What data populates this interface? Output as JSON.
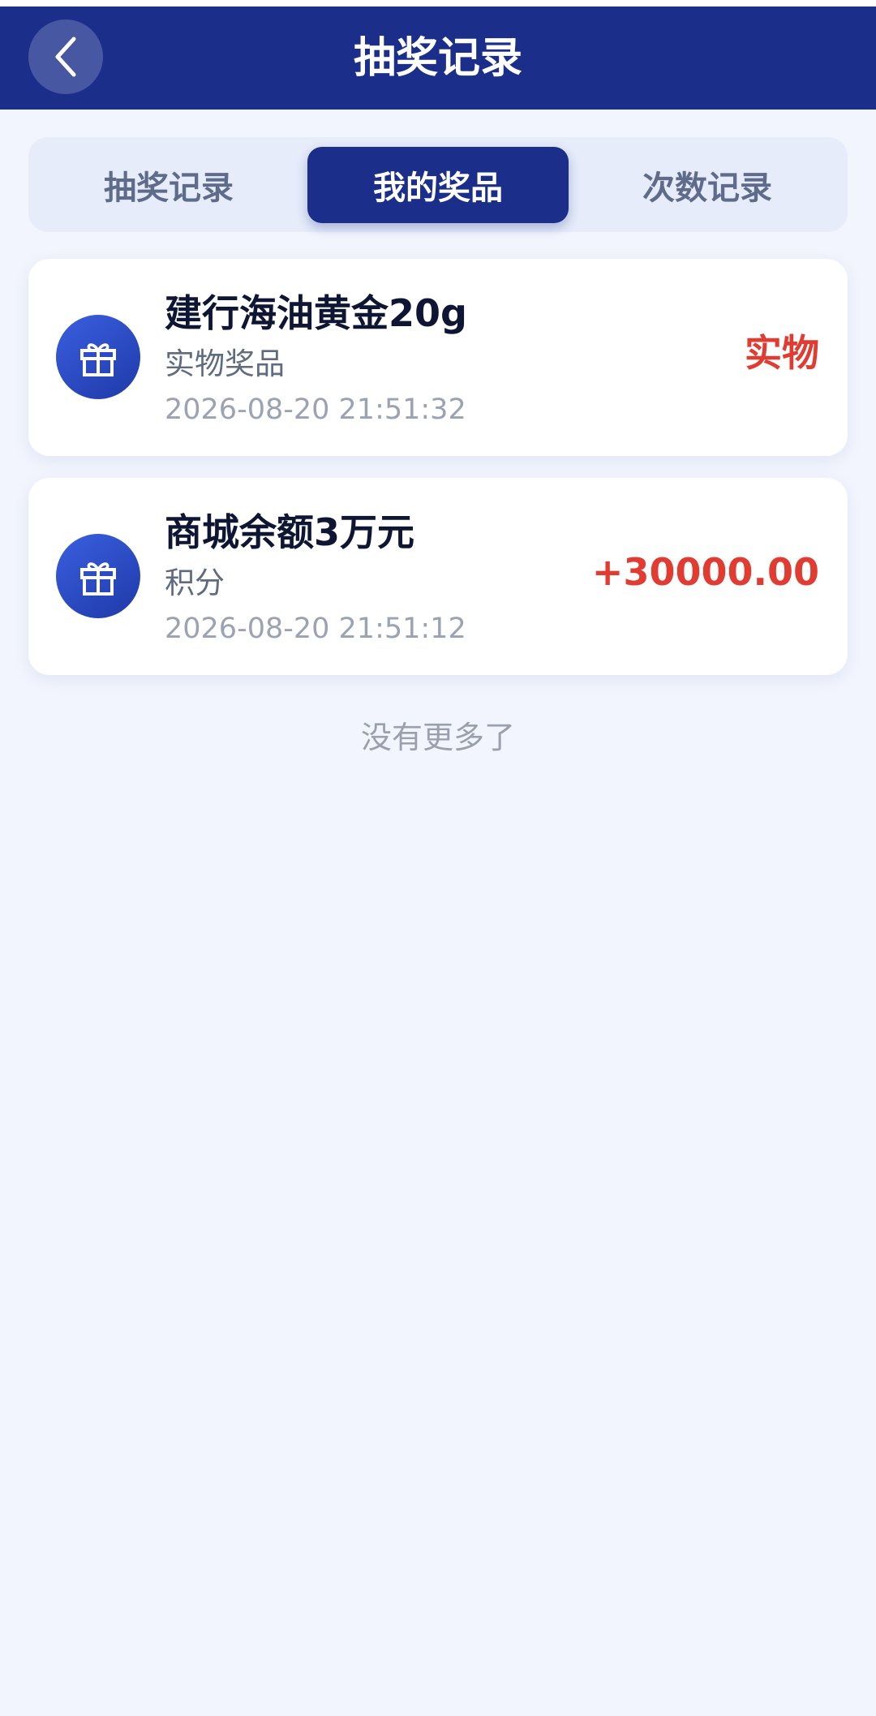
{
  "header": {
    "title": "抽奖记录",
    "back_icon": "chevron-left-icon"
  },
  "tabs": [
    {
      "label": "抽奖记录",
      "active": false
    },
    {
      "label": "我的奖品",
      "active": true
    },
    {
      "label": "次数记录",
      "active": false
    }
  ],
  "prizes": [
    {
      "name": "建行海油黄金20g",
      "type": "实物奖品",
      "time": "2026-08-20 21:51:32",
      "value": "实物",
      "icon": "gift-icon"
    },
    {
      "name": "商城余额3万元",
      "type": "积分",
      "time": "2026-08-20 21:51:12",
      "value": "+30000.00",
      "icon": "gift-icon"
    }
  ],
  "list_end_text": "没有更多了",
  "colors": {
    "primary": "#1a2e8a",
    "accent_red": "#e03c31",
    "background": "#f2f5fd"
  }
}
